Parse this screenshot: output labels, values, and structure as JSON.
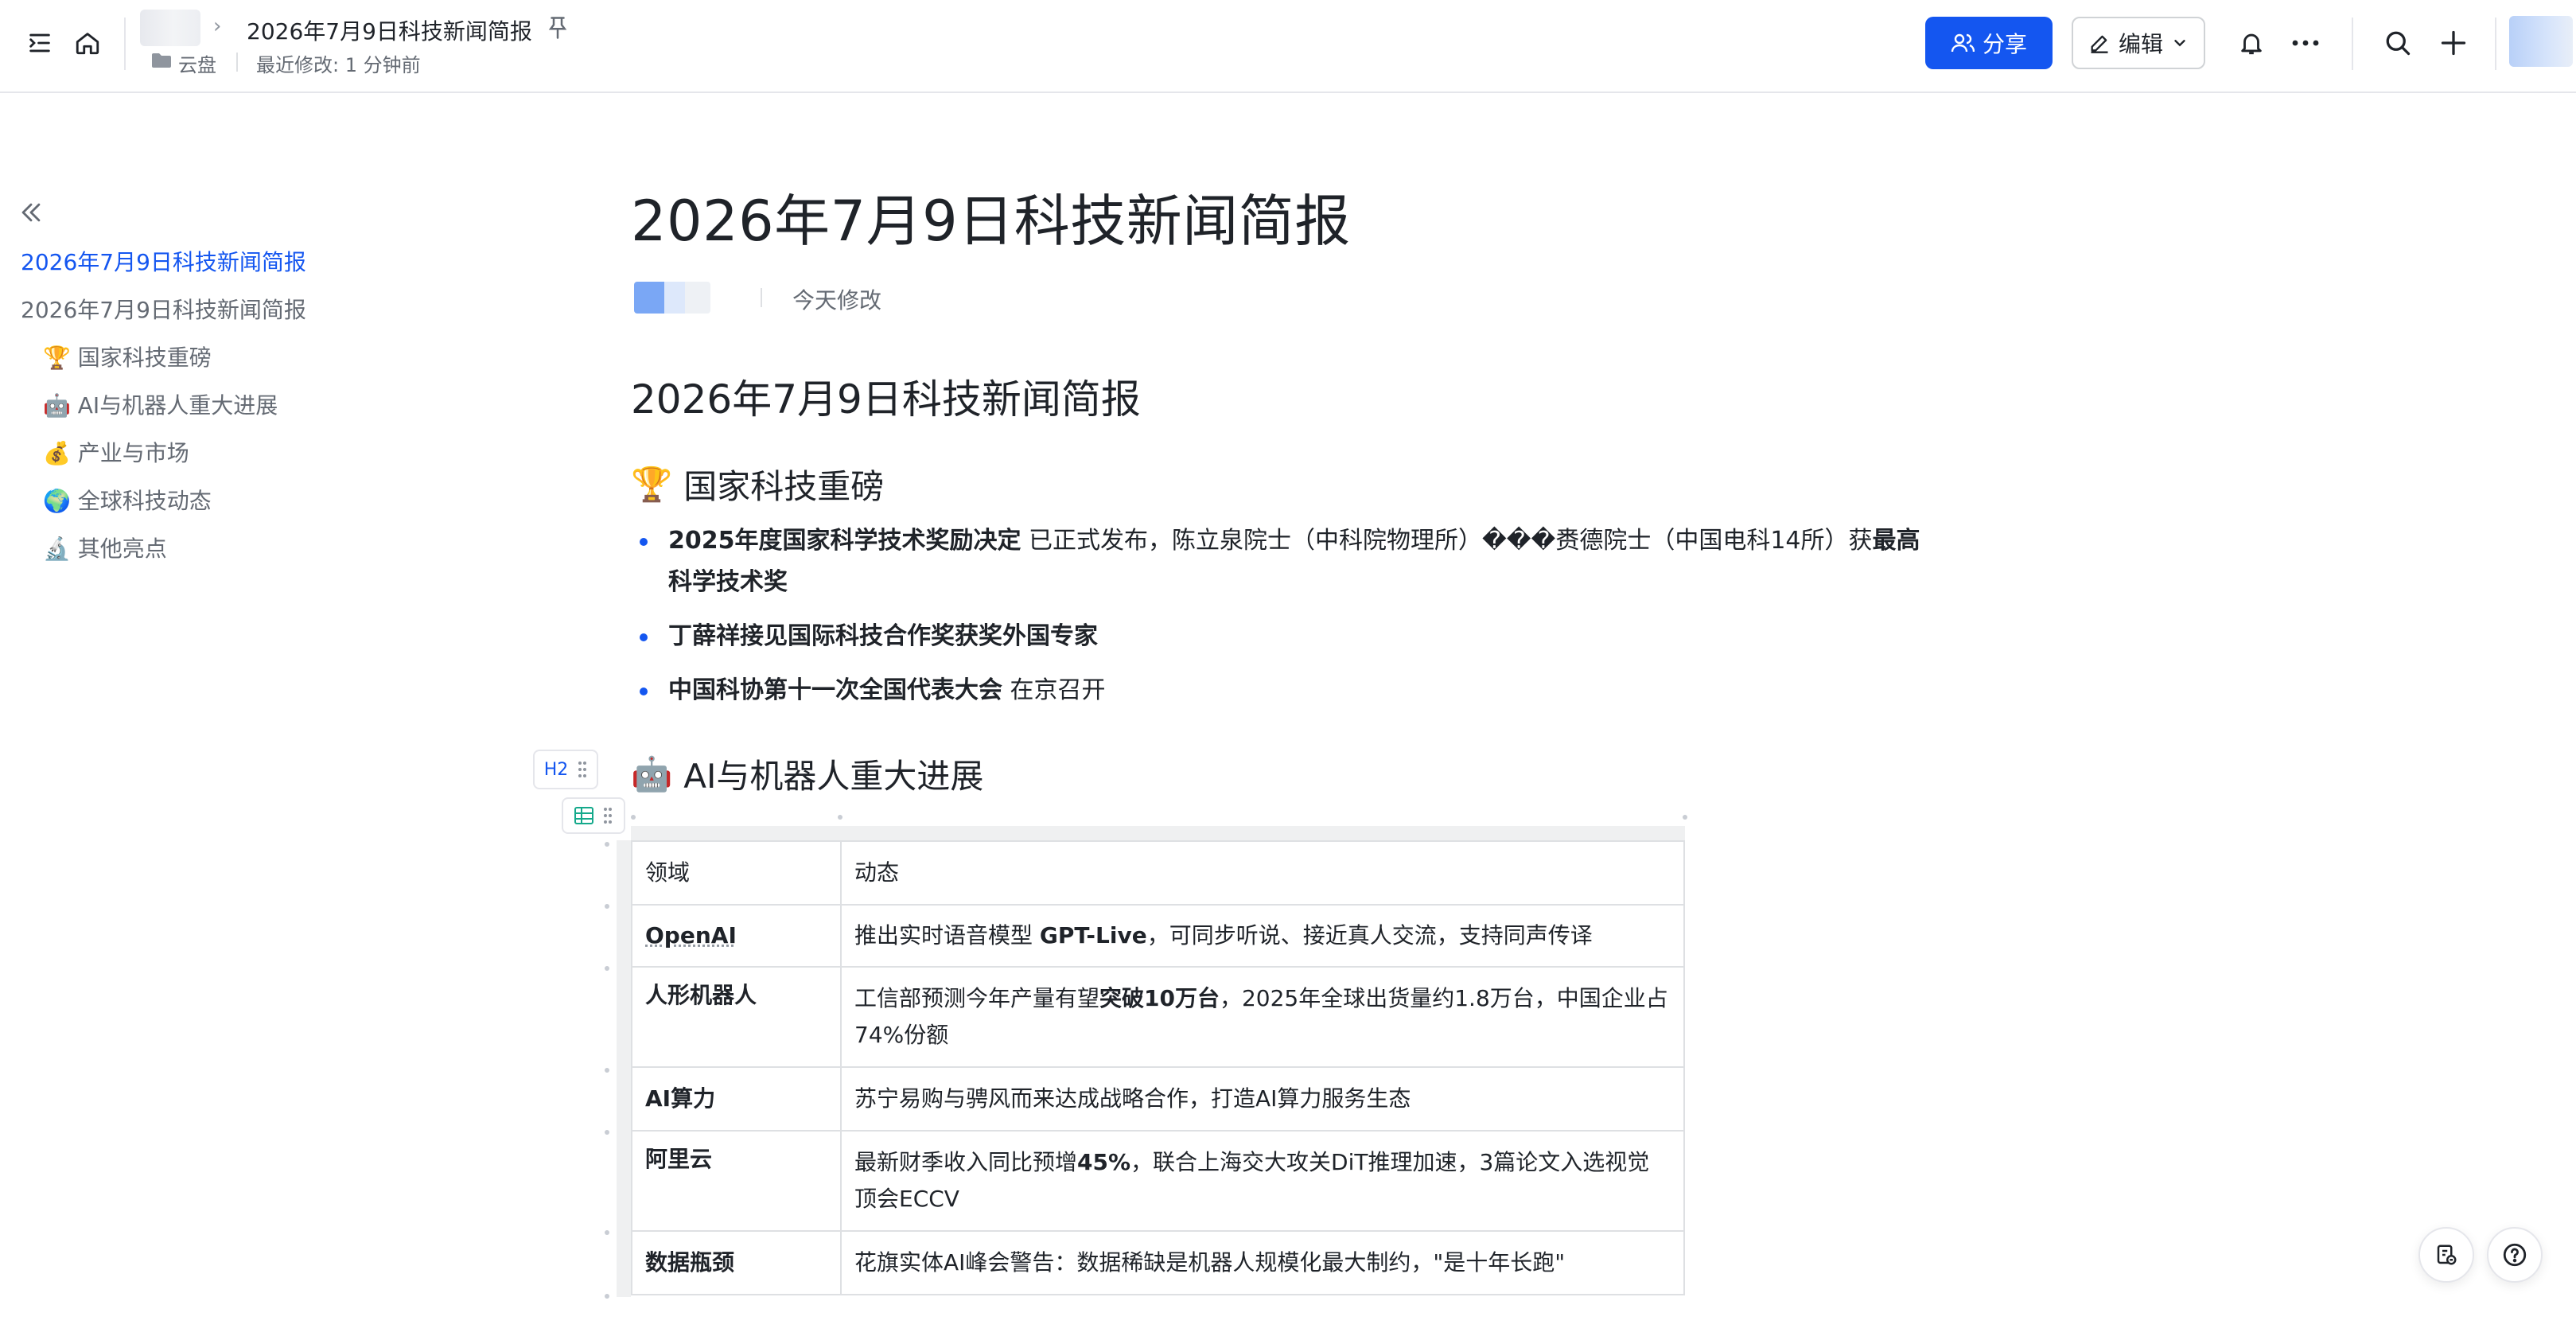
{
  "topbar": {
    "doc_title": "2026年7月9日科技新闻简报",
    "location": "云盘",
    "last_modified": "最近修改: 1 分钟前",
    "share_label": "分享",
    "edit_label": "编辑"
  },
  "toc": {
    "items": [
      {
        "label": "2026年7月9日科技新闻简报"
      },
      {
        "label": "2026年7月9日科技新闻简报"
      },
      {
        "emoji": "🏆",
        "label": "国家科技重磅"
      },
      {
        "emoji": "🤖",
        "label": "AI与机器人重大进展"
      },
      {
        "emoji": "💰",
        "label": "产业与市场"
      },
      {
        "emoji": "🌍",
        "label": "全球科技动态"
      },
      {
        "emoji": "🔬",
        "label": "其他亮点"
      }
    ]
  },
  "doc": {
    "title": "2026年7月9日科技新闻简报",
    "modified": "今天修改",
    "heading1": "2026年7月9日科技新闻简报",
    "section_national": {
      "emoji": "🏆",
      "title": "国家科技重磅",
      "bullets": [
        {
          "bold": "2025年度国家科学技术奖励决定",
          "text": " 已正式发布，陈立泉院士（中科院物理所）���赉德院士（中国电科14所）获",
          "bold2": "最高科学技术奖"
        },
        {
          "bold": "丁薛祥接见国际科技合作奖获奖外国专家",
          "text": ""
        },
        {
          "bold": "中国科协第十一次全国代表大会",
          "text": " 在京召开"
        }
      ]
    },
    "section_ai": {
      "emoji": "🤖",
      "title": "AI与机器人重大进展",
      "handle_label": "H2"
    },
    "table": {
      "headers": [
        "领域",
        "动态"
      ],
      "rows": [
        {
          "field": "OpenAI",
          "pre": "推出实时语音模型 ",
          "bold": "GPT-Live",
          "post": "，可同步听说、接近真人交流，支持同声传译"
        },
        {
          "field": "人形机器人",
          "pre": "工信部预测今年产量有望",
          "bold": "突破10万台",
          "post": "，2025年全球出货量约1.8万台，中国企业占74%份额"
        },
        {
          "field": "AI算力",
          "pre": "苏宁易购与骋风而来达成战略合作，打造AI算力服务生态",
          "bold": "",
          "post": ""
        },
        {
          "field": "阿里云",
          "pre": "最新财季收入同比预增",
          "bold": "45%",
          "post": "，联合上海交大攻关DiT推理加速，3篇论文入选视觉顶会ECCV"
        },
        {
          "field": "数据瓶颈",
          "pre": "花旗实体AI峰会警告：数据稀缺是机器人规模化最大制约，\"是十年长跑\"",
          "bold": "",
          "post": ""
        }
      ]
    }
  },
  "icons": {
    "toc_toggle": "list-indent-icon",
    "home": "home-icon",
    "pin": "pin-icon",
    "folder": "folder-icon",
    "share": "share-users-icon",
    "edit": "pencil-icon",
    "bell": "bell-icon",
    "more": "more-dots-icon",
    "search": "search-icon",
    "add": "plus-icon",
    "collapse": "double-chevron-left-icon",
    "feedback": "feedback-icon",
    "help": "help-icon"
  },
  "colors": {
    "accent": "#1456f0",
    "text": "#1f2329",
    "muted": "#646a73"
  }
}
